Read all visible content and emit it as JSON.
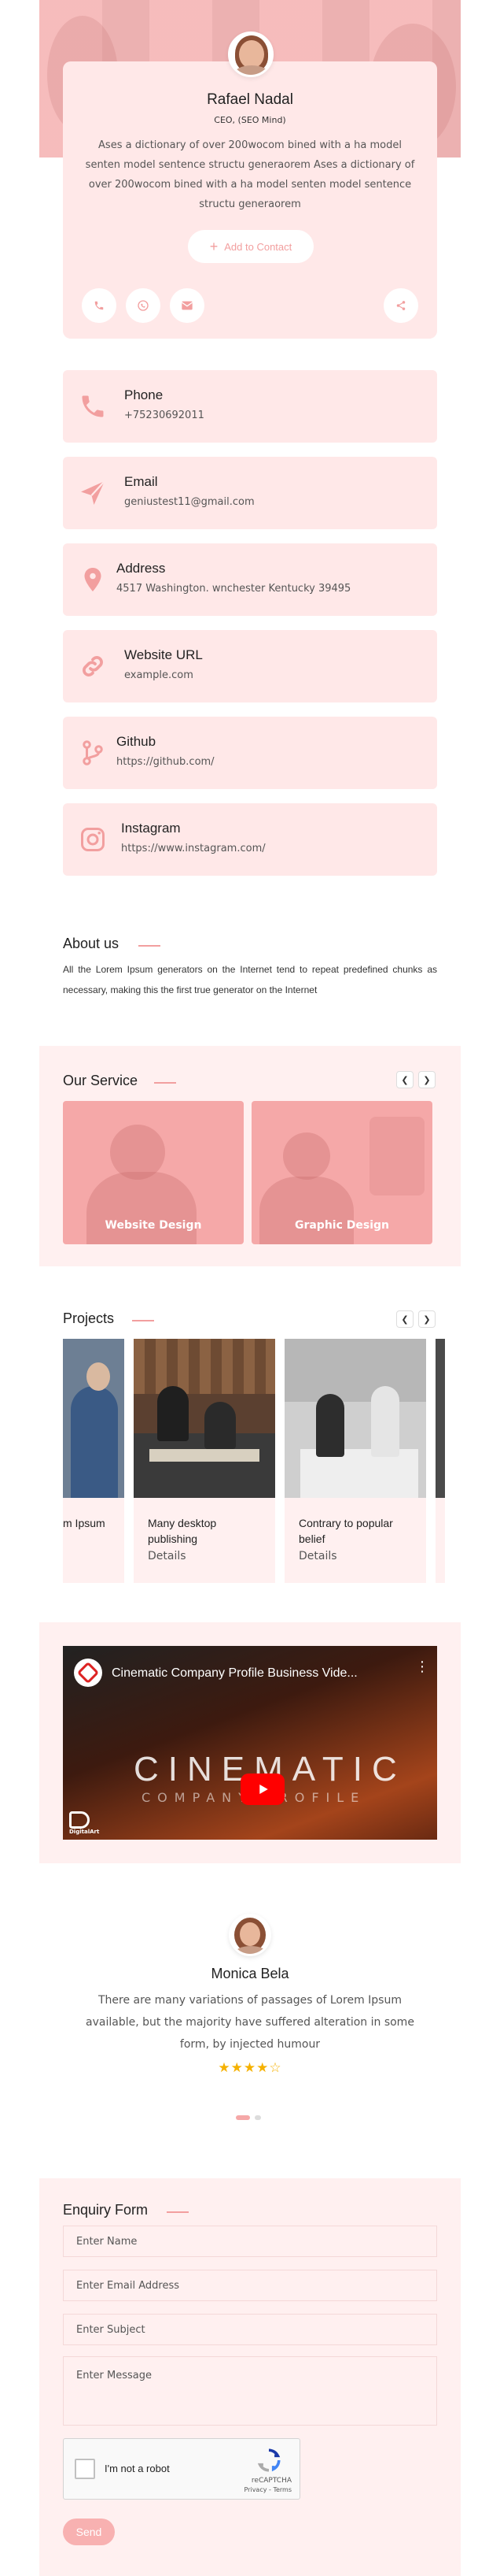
{
  "profile": {
    "name": "Rafael Nadal",
    "role": "CEO, (SEO Mind)",
    "bio": "Ases a dictionary of over 200wocom bined with a ha model senten model sentence structu generaorem Ases a dictionary of over 200wocom bined with a ha model senten model sentence structu generaorem",
    "add_contact_label": "Add to Contact"
  },
  "social_icons": [
    "phone-icon",
    "whatsapp-icon",
    "email-icon",
    "share-icon"
  ],
  "contacts": [
    {
      "title": "Phone",
      "value": "+75230692011",
      "icon": "phone-icon"
    },
    {
      "title": "Email",
      "value": "geniustest11@gmail.com",
      "icon": "send-icon"
    },
    {
      "title": "Address",
      "value": "4517 Washington. wnchester Kentucky 39495",
      "icon": "location-icon"
    },
    {
      "title": "Website URL",
      "value": "example.com",
      "icon": "link-icon"
    },
    {
      "title": "Github",
      "value": "https://github.com/",
      "icon": "git-icon"
    },
    {
      "title": "Instagram",
      "value": "https://www.instagram.com/",
      "icon": "instagram-icon"
    }
  ],
  "about": {
    "title": "About us",
    "text": "All the Lorem Ipsum generators on the Internet tend to repeat predefined chunks as necessary, making this the first true generator on the Internet"
  },
  "services": {
    "title": "Our Service",
    "items": [
      "Website Design",
      "Graphic Design"
    ]
  },
  "projects": {
    "title": "Projects",
    "items": [
      {
        "title": "m Ipsum",
        "link": ""
      },
      {
        "title": "Many desktop publishing",
        "link": "Details"
      },
      {
        "title": "Contrary to popular belief",
        "link": "Details"
      }
    ]
  },
  "video": {
    "title": "Cinematic Company Profile Business Vide...",
    "overlay_big": "CINEMATIC",
    "overlay_small": "COMPANY PROFILE",
    "channel": "DigitalArt"
  },
  "testimonial": {
    "name": "Monica Bela",
    "text": "There are many variations of passages of Lorem Ipsum available, but the majority have suffered alteration in some form, by injected humour",
    "rating": 4,
    "stars": "★★★★☆"
  },
  "enquiry": {
    "title": "Enquiry Form",
    "name_placeholder": "Enter Name",
    "email_placeholder": "Enter Email Address",
    "subject_placeholder": "Enter Subject",
    "message_placeholder": "Enter Message",
    "recaptcha_label": "I'm not a robot",
    "recaptcha_brand": "reCAPTCHA",
    "recaptcha_terms": "Privacy - Terms",
    "send_label": "Send"
  },
  "colors": {
    "accent": "#f29f9f",
    "card_bg": "#ffe8e8",
    "section_bg": "#fff0f0",
    "star": "#f5b100"
  }
}
